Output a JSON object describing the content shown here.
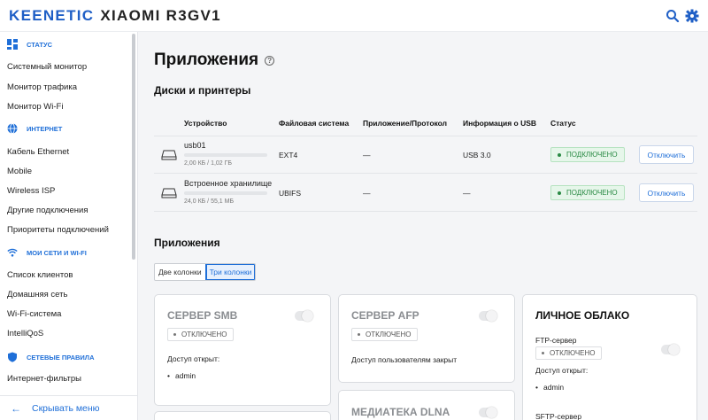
{
  "header": {
    "brand": "KEENETIC",
    "model": "XIAOMI R3GV1",
    "icons": [
      "search-icon",
      "gear-icon"
    ],
    "accent_color": "#1f5fc6"
  },
  "sidebar": {
    "sections": [
      {
        "title": "СТАТУС",
        "icon": "dashboard-icon",
        "items": [
          "Системный монитор",
          "Монитор трафика",
          "Монитор Wi-Fi"
        ]
      },
      {
        "title": "ИНТЕРНЕТ",
        "icon": "globe-icon",
        "items": [
          "Кабель Ethernet",
          "Mobile",
          "Wireless ISP",
          "Другие подключения",
          "Приоритеты подключений"
        ]
      },
      {
        "title": "МОИ СЕТИ И WI-FI",
        "icon": "wifi-icon",
        "items": [
          "Список клиентов",
          "Домашняя сеть",
          "Wi-Fi-система",
          "IntelliQoS"
        ]
      },
      {
        "title": "СЕТЕВЫЕ ПРАВИЛА",
        "icon": "shield-icon",
        "items": [
          "Интернет-фильтры"
        ]
      }
    ],
    "hide_menu": "Скрывать меню"
  },
  "main": {
    "title": "Приложения",
    "disks_title": "Диски и принтеры",
    "columns": [
      "Устройство",
      "Файловая система",
      "Приложение/Протокол",
      "Информация о USB",
      "Статус"
    ],
    "rows": [
      {
        "name": "usb01",
        "size": "2,00 КБ / 1,02 ГБ",
        "fs": "EXT4",
        "protocol": "—",
        "usb": "USB 3.0",
        "status": "ПОДКЛЮЧЕНО",
        "action": "Отключить",
        "usage": 0.002
      },
      {
        "name": "Встроенное хранилище",
        "size": "24,0 КБ / 55,1 МБ",
        "fs": "UBIFS",
        "protocol": "—",
        "usb": "—",
        "status": "ПОДКЛЮЧЕНО",
        "action": "Отключить",
        "usage": 0.0004
      }
    ],
    "apps_title": "Приложения",
    "layout_options": [
      "Две колонки",
      "Три колонки"
    ],
    "layout_selected": "Три колонки",
    "cards": {
      "smb": {
        "title": "СЕРВЕР SMB",
        "status": "ОТКЛЮЧЕНО",
        "access_label": "Доступ открыт:",
        "user": "admin",
        "enabled": false
      },
      "afp": {
        "title": "СЕРВЕР AFP",
        "status": "ОТКЛЮЧЕНО",
        "access_text": "Доступ пользователям закрыт",
        "enabled": false
      },
      "dlna": {
        "title": "МЕДИАТЕКА DLNA",
        "enabled": false
      },
      "cloud": {
        "title": "ЛИЧНОЕ ОБЛАКО",
        "ftp_label": "FTP-сервер",
        "ftp_status": "ОТКЛЮЧЕНО",
        "access_label": "Доступ открыт:",
        "user": "admin",
        "sftp_label": "SFTP-сервер",
        "enabled": false
      }
    }
  }
}
